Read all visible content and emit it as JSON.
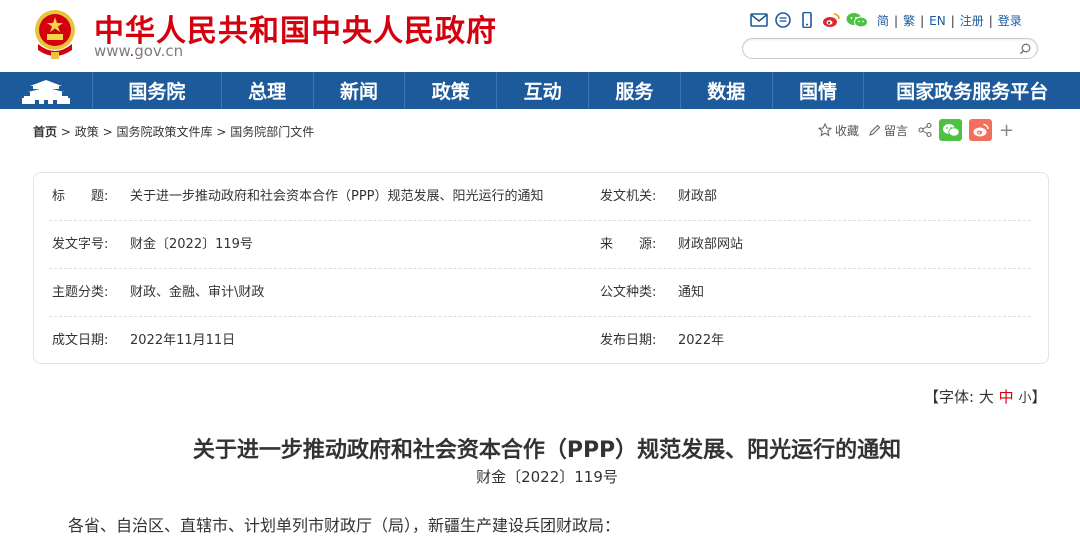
{
  "header": {
    "site_title": "中华人民共和国中央人民政府",
    "site_url_prefix": "www",
    "site_url_dot": ".",
    "site_url_domain": "gov",
    "site_url_suffix": ".cn",
    "lang_links": [
      "简",
      "繁",
      "EN",
      "注册",
      "登录"
    ],
    "search_placeholder": "",
    "icons": [
      "mail-icon",
      "message-icon",
      "mobile-icon",
      "weibo-icon",
      "wechat-icon"
    ],
    "brand_red": "#d4000d",
    "brand_blue": "#1d5a9c"
  },
  "nav": {
    "items": [
      "国务院",
      "总理",
      "新闻",
      "政策",
      "互动",
      "服务",
      "数据",
      "国情",
      "国家政务服务平台"
    ]
  },
  "breadcrumb": {
    "items": [
      "首页",
      "政策",
      "国务院政策文件库",
      "国务院部门文件"
    ],
    "separator": ">"
  },
  "tools": {
    "favorite": "收藏",
    "comment": "留言",
    "share_wechat_color": "#4cc142",
    "share_weibo_color": "#f26f5e"
  },
  "info": {
    "rows": [
      {
        "label_left": "标　　题:",
        "value_left": "关于进一步推动政府和社会资本合作（PPP）规范发展、阳光运行的通知",
        "label_right": "发文机关:",
        "value_right": "财政部"
      },
      {
        "label_left": "发文字号:",
        "value_left": "财金〔2022〕119号",
        "label_right": "来　　源:",
        "value_right": "财政部网站"
      },
      {
        "label_left": "主题分类:",
        "value_left": "财政、金融、审计\\财政",
        "label_right": "公文种类:",
        "value_right": "通知"
      },
      {
        "label_left": "成文日期:",
        "value_left": "2022年11月11日",
        "label_right": "发布日期:",
        "value_right": "2022年"
      }
    ]
  },
  "fontsize": {
    "prefix": "【字体:",
    "large": "大",
    "medium": "中",
    "small": "小",
    "suffix": "】"
  },
  "article": {
    "title": "关于进一步推动政府和社会资本合作（PPP）规范发展、阳光运行的通知",
    "doc_number": "财金〔2022〕119号",
    "salutation": "各省、自治区、直辖市、计划单列市财政厅（局），新疆生产建设兵团财政局："
  }
}
